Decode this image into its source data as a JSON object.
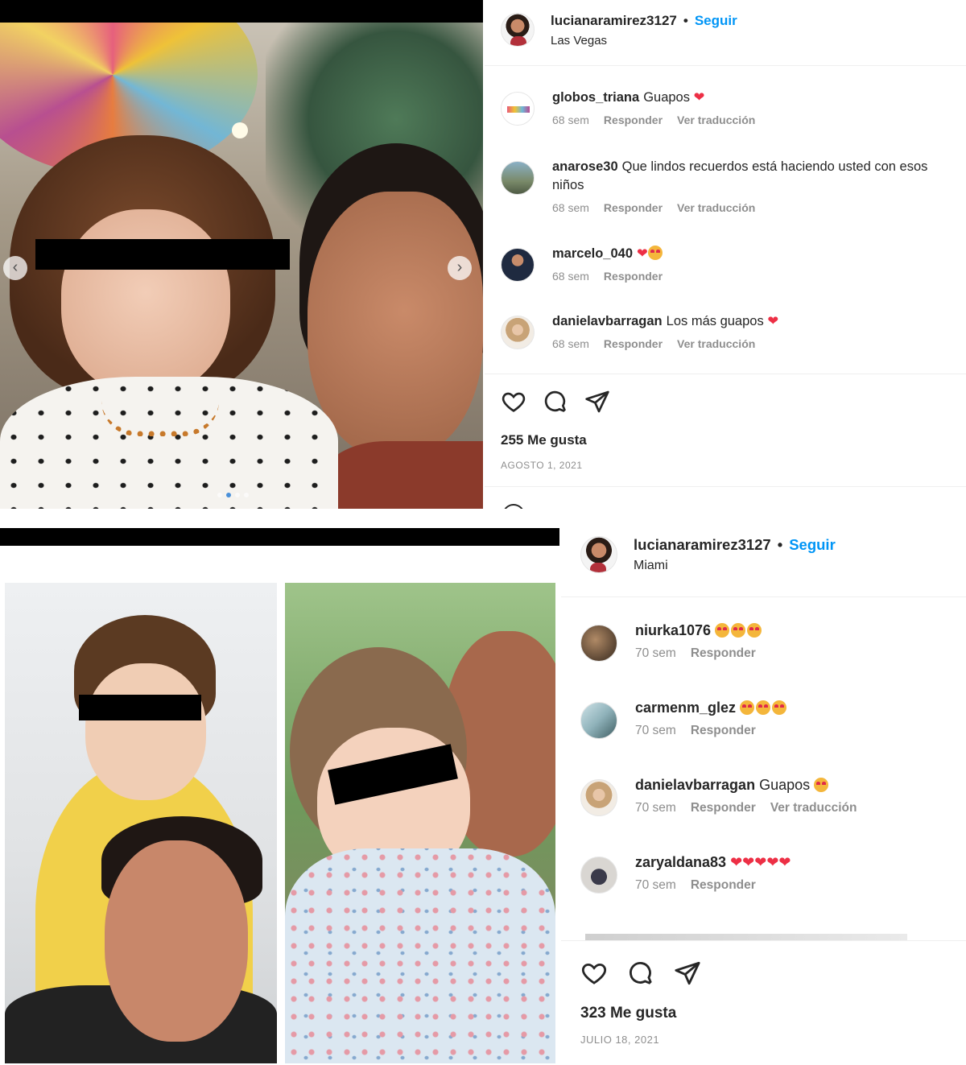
{
  "post1": {
    "username": "lucianaramirez3127",
    "follow_label": "Seguir",
    "location": "Las Vegas",
    "comments": [
      {
        "user": "globos_triana",
        "text": "Guapos",
        "emoji": "❤",
        "time": "68 sem",
        "reply": "Responder",
        "translate": "Ver traducción"
      },
      {
        "user": "anarose30",
        "text": "Que lindos recuerdos está haciendo usted con esos niños",
        "emoji": "",
        "time": "68 sem",
        "reply": "Responder",
        "translate": "Ver traducción"
      },
      {
        "user": "marcelo_040",
        "text": "",
        "emoji": "❤",
        "time": "68 sem",
        "reply": "Responder",
        "translate": ""
      },
      {
        "user": "danielavbarragan",
        "text": "Los más guapos",
        "emoji": "❤",
        "time": "68 sem",
        "reply": "Responder",
        "translate": "Ver traducción"
      }
    ],
    "likes": "255 Me gusta",
    "date": "AGOSTO 1, 2021",
    "carousel": {
      "slide_count": 4,
      "active_index": 1
    }
  },
  "post2": {
    "username": "lucianaramirez3127",
    "follow_label": "Seguir",
    "location": "Miami",
    "comments": [
      {
        "user": "niurka1076",
        "text": "",
        "time": "70 sem",
        "reply": "Responder",
        "translate": ""
      },
      {
        "user": "carmenm_glez",
        "text": "",
        "time": "70 sem",
        "reply": "Responder",
        "translate": ""
      },
      {
        "user": "danielavbarragan",
        "text": "Guapos",
        "time": "70 sem",
        "reply": "Responder",
        "translate": "Ver traducción"
      },
      {
        "user": "zaryaldana83",
        "text": "",
        "hearts": "❤❤❤❤❤",
        "time": "70 sem",
        "reply": "Responder",
        "translate": ""
      }
    ],
    "likes": "323 Me gusta",
    "date": "JULIO 18, 2021"
  },
  "colors": {
    "accent": "#0095f6",
    "heart": "#ed2f45",
    "muted": "#8e8e8e",
    "text": "#262626"
  },
  "icons": [
    "heart-icon",
    "comment-icon",
    "share-icon",
    "chevron-left-icon",
    "chevron-right-icon"
  ]
}
